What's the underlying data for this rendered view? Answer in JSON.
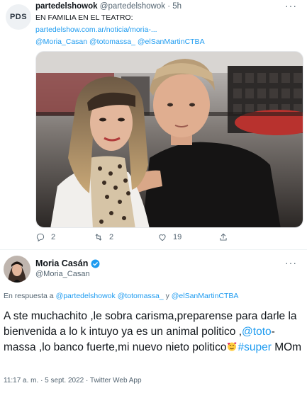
{
  "quoted_tweet": {
    "avatar_text": "PDS",
    "display_name": "partedelshowok",
    "handle": "@partedelshowok",
    "separator": "·",
    "time": "5h",
    "more": "···",
    "text": "EN FAMILIA EN EL TEATRO:",
    "link": "partedelshow.com.ar/noticia/moria-...",
    "mentions": "@Moria_Casan @totomassa_ @elSanMartinCTBA",
    "actions": {
      "replies": "2",
      "retweets": "2",
      "likes": "19"
    }
  },
  "tweet": {
    "display_name": "Moria Casán",
    "handle": "@Moria_Casan",
    "more": "···",
    "reply_prefix": "En respuesta a",
    "reply_mentions": [
      "@partedelshowok",
      "@totomassa_",
      "y",
      "@elSanMartinCTBA"
    ],
    "body_part1": "A ste muchachito ,le sobra carisma,preparense para darle la bienvenida a lo k intuyo ya es un animal politico ,",
    "body_mention": "@toto",
    "body_part2": "-massa ,lo banco fuerte,mi nuevo nieto politico",
    "body_emoji": "smiling-face-with-hearts-icon",
    "body_hashtag": "#super",
    "body_part3": " MOm",
    "timestamp": "11:17 a. m. · 5 sept. 2022 · Twitter Web App"
  },
  "colors": {
    "link_blue": "#1d9bf0",
    "secondary_text": "#536471",
    "verified_blue": "#1d9bf0"
  }
}
